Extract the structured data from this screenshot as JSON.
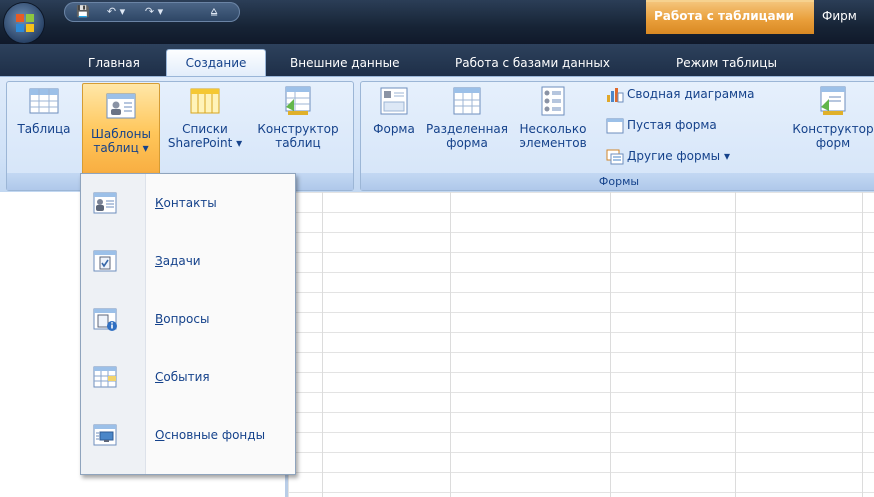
{
  "titlebar": {
    "qat": {
      "save_label": "💾",
      "undo_label": "↶ ▾",
      "redo_label": "↷ ▾",
      "customize_label": "⩠"
    },
    "context_tab_label": "Работа с таблицами",
    "title_rest": "Фирм"
  },
  "tabs": [
    "Главная",
    "Создание",
    "Внешние данные",
    "Работа с базами данных",
    "Режим таблицы"
  ],
  "ribbon": {
    "tables_group": {
      "table": "Таблица",
      "templates_line1": "Шаблоны",
      "templates_line2": "таблиц ▾",
      "lists_line1": "Списки",
      "lists_line2": "SharePoint ▾",
      "designer_line1": "Конструктор",
      "designer_line2": "таблиц"
    },
    "forms_group": {
      "label": "Формы",
      "form": "Форма",
      "split_line1": "Разделенная",
      "split_line2": "форма",
      "multiple_line1": "Несколько",
      "multiple_line2": "элементов",
      "pivot_chart": "Сводная диаграмма",
      "blank_form": "Пустая форма",
      "more_forms": "Другие формы ▾",
      "designer_line1": "Конструктор",
      "designer_line2": "форм"
    }
  },
  "menu": {
    "items": [
      {
        "hot": "К",
        "rest": "онтакты",
        "icon": "contacts-icon"
      },
      {
        "hot": "З",
        "rest": "адачи",
        "icon": "tasks-icon"
      },
      {
        "hot": "В",
        "rest": "опросы",
        "icon": "issues-icon"
      },
      {
        "hot": "С",
        "rest": "обытия",
        "icon": "events-icon"
      },
      {
        "hot": "О",
        "rest": "сновные фонды",
        "icon": "assets-icon"
      }
    ]
  },
  "colors": {
    "accent": "#15428b",
    "context_tab": "#e99f3b",
    "selected": "#ffc65a"
  }
}
